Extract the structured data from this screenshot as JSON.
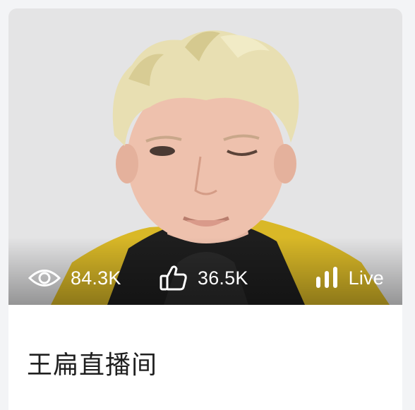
{
  "card": {
    "stats": {
      "views": "84.3K",
      "likes": "36.5K",
      "live_label": "Live"
    },
    "title": "王扁直播间"
  },
  "icons": {
    "views": "eye-icon",
    "likes": "thumbs-up-icon",
    "live": "signal-bars-icon"
  }
}
